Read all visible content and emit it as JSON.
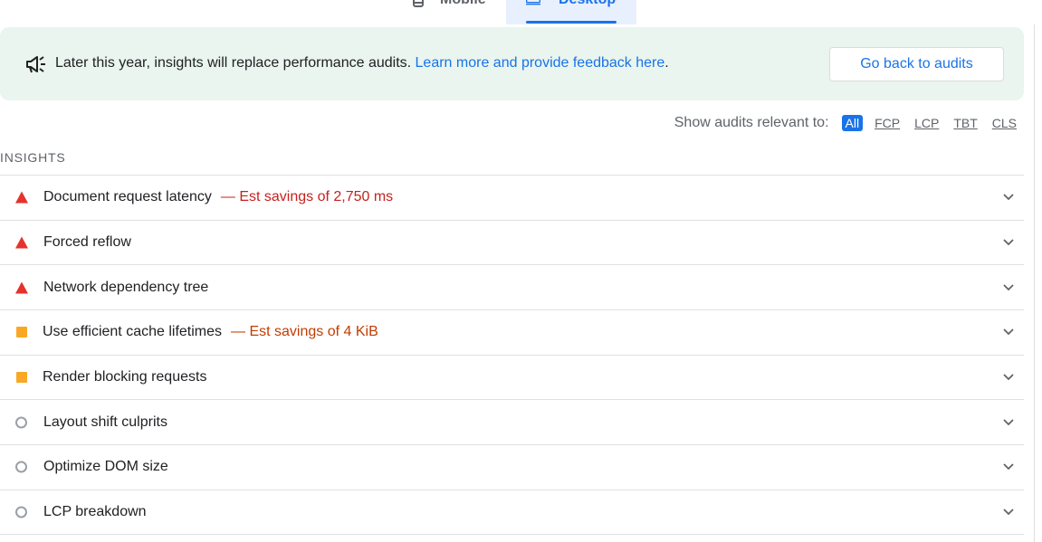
{
  "device_tabs": [
    {
      "label": "Mobile",
      "active": false
    },
    {
      "label": "Desktop",
      "active": true
    }
  ],
  "banner": {
    "icon": "megaphone-icon",
    "message": "Later this year, insights will replace performance audits.",
    "link_text": "Learn more and provide feedback here",
    "link_suffix": ".",
    "button_label": "Go back to audits",
    "background_color": "#e9f5ee"
  },
  "filter": {
    "label": "Show audits relevant to:",
    "options": [
      "All",
      "FCP",
      "LCP",
      "TBT",
      "CLS"
    ],
    "selected": "All"
  },
  "section_title": "INSIGHTS",
  "audits": [
    {
      "title": "Document request latency",
      "savings": "— Est savings of 2,750 ms",
      "status": "fail"
    },
    {
      "title": "Forced reflow",
      "savings": "",
      "status": "fail"
    },
    {
      "title": "Network dependency tree",
      "savings": "",
      "status": "fail"
    },
    {
      "title": "Use efficient cache lifetimes",
      "savings": "— Est savings of 4 KiB",
      "status": "average"
    },
    {
      "title": "Render blocking requests",
      "savings": "",
      "status": "average"
    },
    {
      "title": "Layout shift culprits",
      "savings": "",
      "status": "info"
    },
    {
      "title": "Optimize DOM size",
      "savings": "",
      "status": "info"
    },
    {
      "title": "LCP breakdown",
      "savings": "",
      "status": "info"
    }
  ],
  "colors": {
    "fail": "#e5322d",
    "average": "#f9a825",
    "info": "#9aa0a6",
    "accent": "#1a73e8",
    "savings_red": "#c5221f",
    "savings_orange": "#c23d03"
  }
}
